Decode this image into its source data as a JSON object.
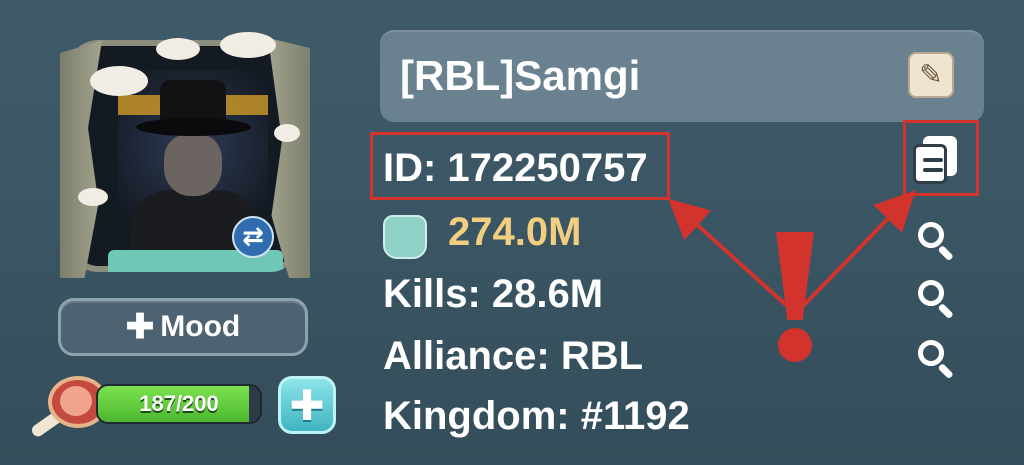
{
  "profile": {
    "name": "[RBL]Samgi",
    "id_label": "ID: 172250757",
    "power": "274.0M",
    "kills_label": "Kills: 28.6M",
    "alliance_label": "Alliance: RBL",
    "kingdom_label": "Kingdom: #1192"
  },
  "mood": {
    "plus": "✚",
    "label": "Mood"
  },
  "stamina": {
    "text": "187/200",
    "current": 187,
    "max": 200,
    "add": "✚"
  },
  "icons": {
    "edit": "edit-icon",
    "copy": "copy-icon",
    "search": "search-icon",
    "swap": "swap-icon",
    "power": "fist-icon",
    "stamina": "meat-icon"
  },
  "annotation": {
    "exclamation_color": "#d2332c",
    "box_color": "#d2332c"
  },
  "glyphs": {
    "edit": "✎",
    "swap": "⇄"
  }
}
